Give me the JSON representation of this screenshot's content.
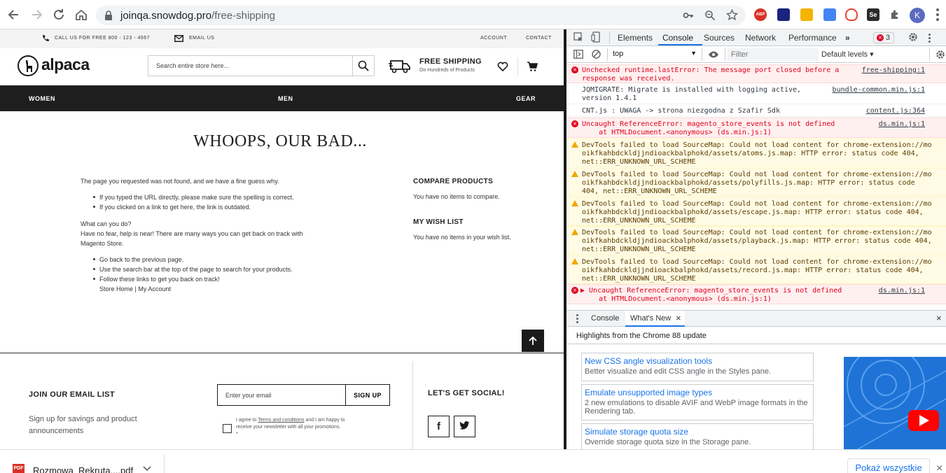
{
  "browser": {
    "url_host": "joinqa.snowdog.pro",
    "url_path": "/free-shipping",
    "profile_initial": "K",
    "extensions": [
      "ABP",
      "Se"
    ]
  },
  "page": {
    "topbar": {
      "phone": "CALL US FOR FREE 800 - 123 - 4567",
      "email": "EMAIL US",
      "account": "ACCOUNT",
      "contact": "CONTACT"
    },
    "logo": "alpaca",
    "search_placeholder": "Search entire store here...",
    "shipping": {
      "title": "FREE SHIPPING",
      "subtitle": "On Hundreds of Products"
    },
    "nav": [
      "WOMEN",
      "MEN",
      "GEAR"
    ],
    "title": "WHOOPS, OUR BAD...",
    "intro": "The page you requested was not found, and we have a fine guess why.",
    "reasons": [
      "If you typed the URL directly, please make sure the spelling is correct.",
      "If you clicked on a link to get here, the link is outdated."
    ],
    "what_can_you_do": "What can you do?",
    "help_line1": "Have no fear, help is near! There are many ways you can get back on track with",
    "help_line2": "Magento Store.",
    "options": [
      "Go back to the previous page.",
      "Use the search bar at the top of the page to search for your products.",
      "Follow these links to get you back on track!"
    ],
    "store_home": "Store Home",
    "link_sep": "|",
    "my_account": "My Account",
    "compare": {
      "title": "COMPARE PRODUCTS",
      "text": "You have no items to compare."
    },
    "wishlist": {
      "title": "MY WISH LIST",
      "text": "You have no items in your wish list."
    },
    "footer": {
      "join_title": "JOIN OUR EMAIL LIST",
      "join_line1": "Sign up for savings and product",
      "join_line2": "announcements",
      "email_placeholder": "Enter your email",
      "signup": "SIGN UP",
      "agree_pre": "I agree to ",
      "agree_link": "Terms and conditions",
      "agree_post": " and I am happy to",
      "agree_line2": "receive your newsletter with all your promotions.",
      "agree_star": "*",
      "social_title": "LET'S GET SOCIAL!",
      "social": [
        "f",
        "twitter-bird"
      ]
    }
  },
  "devtools": {
    "tabs": [
      "Elements",
      "Console",
      "Sources",
      "Network",
      "Performance"
    ],
    "more": "»",
    "error_count": "3",
    "context": "top",
    "filter_placeholder": "Filter",
    "levels": "Default levels ▾",
    "messages": [
      {
        "level": "error",
        "lines": [
          "Unchecked runtime.lastError: The message port closed before a",
          "response was received."
        ],
        "source": "free-shipping:1"
      },
      {
        "level": "info",
        "lines": [
          "JQMIGRATE: Migrate is installed with logging active,",
          "version 1.4.1"
        ],
        "source": "bundle-common.min.js:1"
      },
      {
        "level": "info",
        "lines": [
          "CNT.js : UWAGA -> strona niezgodna z Szafir Sdk"
        ],
        "source": "content.js:364"
      },
      {
        "level": "error",
        "lines": [
          "Uncaught ReferenceError: magento_store_events is not defined",
          "    at HTMLDocument.<anonymous> (ds.min.js:1)"
        ],
        "source": "ds.min.js:1"
      },
      {
        "level": "warning",
        "lines": [
          "DevTools failed to load SourceMap: Could not load content for chrome-extension://mo",
          "oikfkahbdckldjjndioackbalphokd/assets/atoms.js.map: HTTP error: status code 404,",
          "net::ERR_UNKNOWN_URL_SCHEME"
        ],
        "source": ""
      },
      {
        "level": "warning",
        "lines": [
          "DevTools failed to load SourceMap: Could not load content for chrome-extension://mo",
          "oikfkahbdckldjjndioackbalphokd/assets/polyfills.js.map: HTTP error: status code",
          "404, net::ERR_UNKNOWN_URL_SCHEME"
        ],
        "source": ""
      },
      {
        "level": "warning",
        "lines": [
          "DevTools failed to load SourceMap: Could not load content for chrome-extension://mo",
          "oikfkahbdckldjjndioackbalphokd/assets/escape.js.map: HTTP error: status code 404,",
          "net::ERR_UNKNOWN_URL_SCHEME"
        ],
        "source": ""
      },
      {
        "level": "warning",
        "lines": [
          "DevTools failed to load SourceMap: Could not load content for chrome-extension://mo",
          "oikfkahbdckldjjndioackbalphokd/assets/playback.js.map: HTTP error: status code 404,",
          "net::ERR_UNKNOWN_URL_SCHEME"
        ],
        "source": ""
      },
      {
        "level": "warning",
        "lines": [
          "DevTools failed to load SourceMap: Could not load content for chrome-extension://mo",
          "oikfkahbdckldjjndioackbalphokd/assets/record.js.map: HTTP error: status code 404,",
          "net::ERR_UNKNOWN_URL_SCHEME"
        ],
        "source": ""
      },
      {
        "level": "error",
        "lines": [
          "▶ Uncaught ReferenceError: magento_store_events is not defined",
          "    at HTMLDocument.<anonymous> (ds.min.js:1)"
        ],
        "source": "ds.min.js:1"
      }
    ],
    "drawer_tabs": [
      "Console",
      "What's New"
    ],
    "highlights": "Highlights from the Chrome 88 update",
    "cards": [
      {
        "title": "New CSS angle visualization tools",
        "desc": "Better visualize and edit CSS angle in the Styles pane."
      },
      {
        "title": "Emulate unsupported image types",
        "desc": "2 new emulations to disable AVIF and WebP image formats in the Rendering tab."
      },
      {
        "title": "Simulate storage quota size",
        "desc": "Override storage quota size in the Storage pane."
      }
    ]
  },
  "downloads": {
    "file": "Rozmowa_Rekruta....pdf",
    "show_all": "Pokaż wszystkie"
  },
  "colors": {
    "accent": "#1a73e8",
    "error": "#e0001a",
    "warning": "#f2a600",
    "nav_bg": "#1e1e1e"
  }
}
